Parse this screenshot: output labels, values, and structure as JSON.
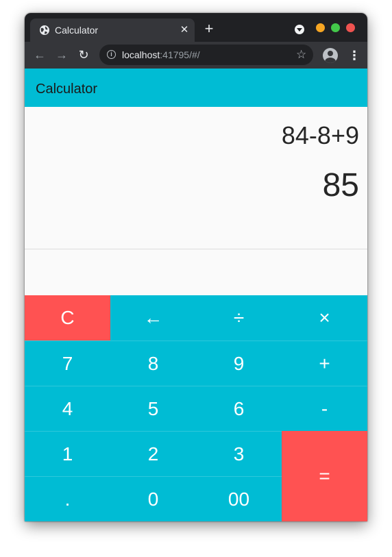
{
  "browser": {
    "tab_title": "Calculator",
    "tab_close": "✕",
    "new_tab": "+",
    "url_host": "localhost",
    "url_rest": ":41795/#/",
    "info_glyph": "i",
    "star_glyph": "☆",
    "menu_glyph": "⋮",
    "back_glyph": "←",
    "forward_glyph": "→",
    "reload_glyph": "↻",
    "traffic_colors": {
      "minimize": "#f6a623",
      "maximize": "#43c84a",
      "close": "#ef5350"
    },
    "icons": [
      "globe-icon",
      "close-icon",
      "plus-icon",
      "tab-search-icon",
      "back-arrow-icon",
      "forward-arrow-icon",
      "reload-icon",
      "info-icon",
      "star-icon",
      "profile-icon",
      "kebab-menu-icon"
    ]
  },
  "app": {
    "title": "Calculator",
    "accent_color": "#00bcd4",
    "operator_color": "#ff5252"
  },
  "display": {
    "expression": "84-8+9",
    "result": "85"
  },
  "keypad": {
    "clear": "C",
    "backspace": "←",
    "divide": "÷",
    "multiply": "×",
    "seven": "7",
    "eight": "8",
    "nine": "9",
    "plus": "+",
    "four": "4",
    "five": "5",
    "six": "6",
    "minus": "-",
    "one": "1",
    "two": "2",
    "three": "3",
    "equals": "=",
    "dot": ".",
    "zero": "0",
    "double_zero": "00"
  }
}
